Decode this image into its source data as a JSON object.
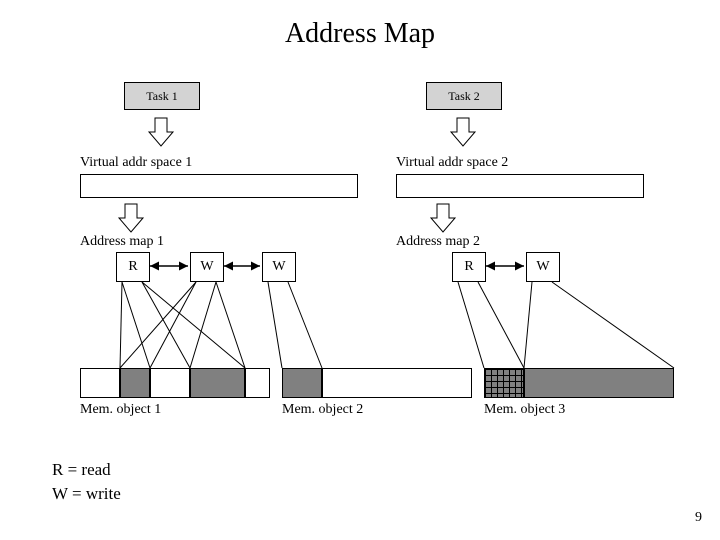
{
  "title": "Address Map",
  "tasks": {
    "t1": "Task 1",
    "t2": "Task 2"
  },
  "vas_labels": {
    "v1": "Virtual addr space 1",
    "v2": "Virtual addr space 2"
  },
  "map_labels": {
    "m1": "Address map 1",
    "m2": "Address map 2"
  },
  "mapbox": {
    "m1a": "R",
    "m1b": "W",
    "m1c": "W",
    "m2a": "R",
    "m2b": "W"
  },
  "mem_labels": {
    "o1": "Mem. object 1",
    "o2": "Mem. object 2",
    "o3": "Mem. object 3"
  },
  "legend": {
    "r": "R = read",
    "w": "W = write"
  },
  "page_number": "9"
}
